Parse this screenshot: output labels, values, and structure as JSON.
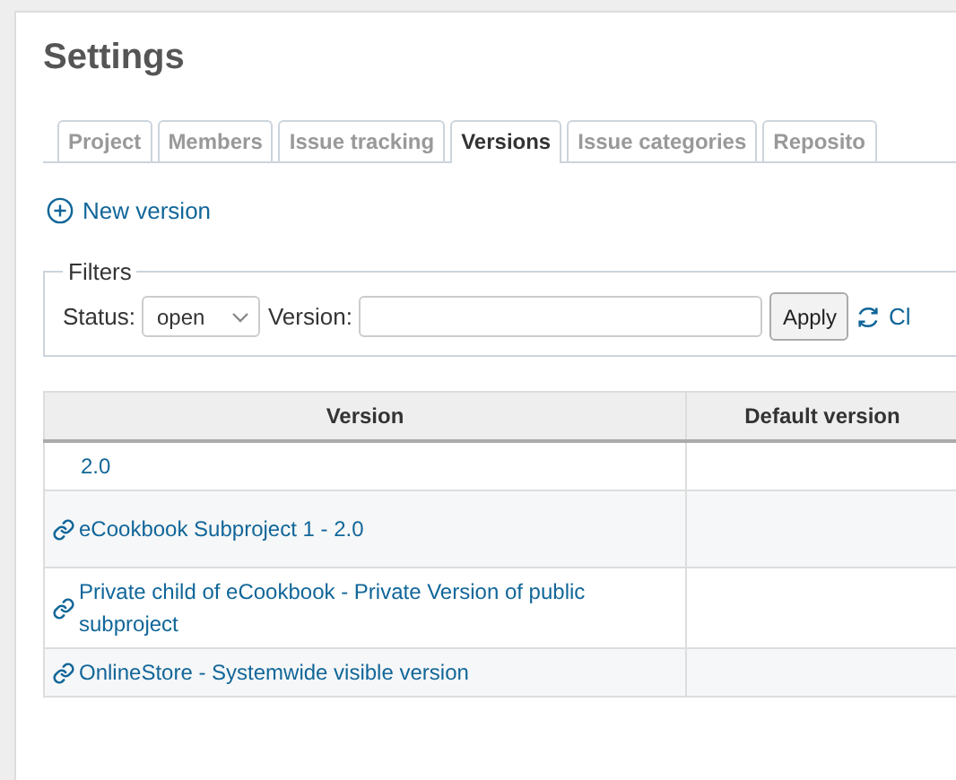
{
  "title": "Settings",
  "tabs": [
    {
      "label": "Project",
      "selected": false
    },
    {
      "label": "Members",
      "selected": false
    },
    {
      "label": "Issue tracking",
      "selected": false
    },
    {
      "label": "Versions",
      "selected": true
    },
    {
      "label": "Issue categories",
      "selected": false
    },
    {
      "label": "Reposito",
      "selected": false
    }
  ],
  "new_version": "New version",
  "filters": {
    "legend": "Filters",
    "status_label": "Status:",
    "status_value": "open",
    "version_label": "Version:",
    "apply": "Apply",
    "clear": "Cl"
  },
  "table": {
    "columns": [
      "Version",
      "Default version"
    ],
    "rows": [
      {
        "name": "2.0",
        "shared": false
      },
      {
        "name": "eCookbook Subproject 1 - 2.0",
        "shared": true
      },
      {
        "name": "Private child of eCookbook - Private Version of public subproject",
        "shared": true
      },
      {
        "name": "OnlineStore - Systemwide visible version",
        "shared": true
      }
    ]
  }
}
